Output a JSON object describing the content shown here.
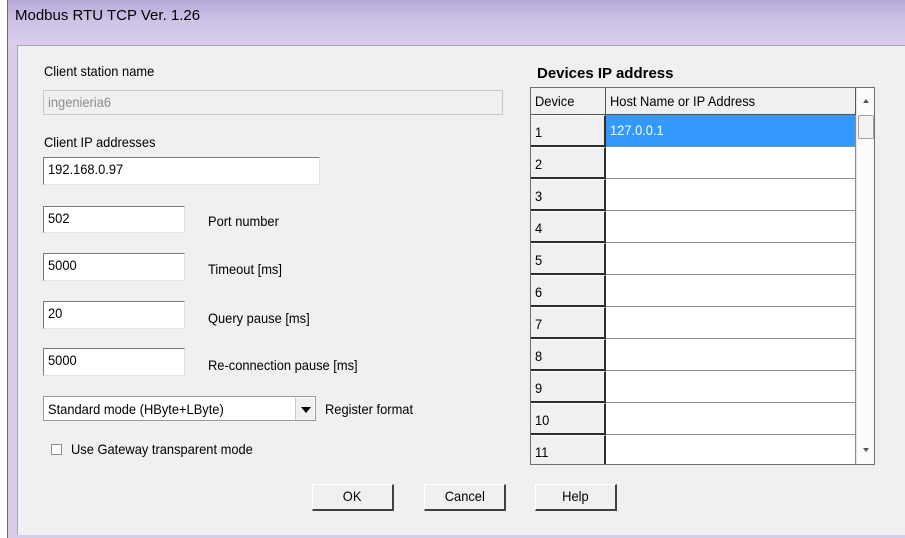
{
  "window": {
    "title": "Modbus RTU TCP  Ver. 1.26"
  },
  "client_station": {
    "label": "Client station name",
    "value": "ingenieria6"
  },
  "client_ip": {
    "label": "Client IP addresses",
    "value": "192.168.0.97"
  },
  "port": {
    "value": "502",
    "label": "Port number"
  },
  "timeout": {
    "value": "5000",
    "label": "Timeout [ms]"
  },
  "query_pause": {
    "value": "20",
    "label": "Query pause [ms]"
  },
  "reconnect_pause": {
    "value": "5000",
    "label": "Re-connection pause [ms]"
  },
  "register_format": {
    "selected": "Standard mode (HByte+LByte)",
    "label": "Register format"
  },
  "gateway_mode": {
    "label": "Use Gateway transparent mode",
    "checked": false
  },
  "devices": {
    "heading": "Devices IP address",
    "columns": [
      "Device",
      "Host Name or IP Address"
    ],
    "rows": [
      {
        "device": "1",
        "host": "127.0.0.1"
      },
      {
        "device": "2",
        "host": ""
      },
      {
        "device": "3",
        "host": ""
      },
      {
        "device": "4",
        "host": ""
      },
      {
        "device": "5",
        "host": ""
      },
      {
        "device": "6",
        "host": ""
      },
      {
        "device": "7",
        "host": ""
      },
      {
        "device": "8",
        "host": ""
      },
      {
        "device": "9",
        "host": ""
      },
      {
        "device": "10",
        "host": ""
      },
      {
        "device": "11",
        "host": ""
      }
    ]
  },
  "buttons": {
    "ok": "OK",
    "cancel": "Cancel",
    "help": "Help"
  }
}
